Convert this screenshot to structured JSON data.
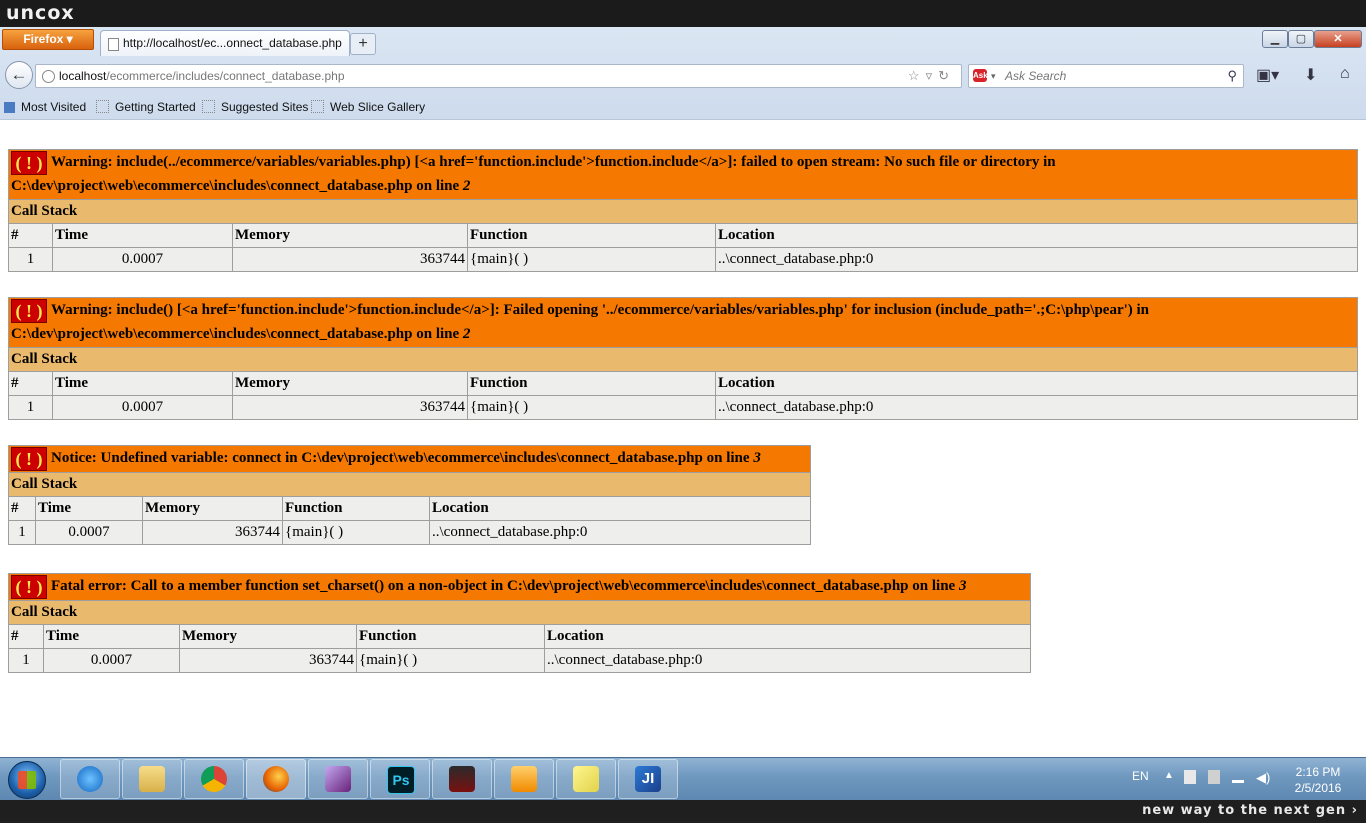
{
  "os": {
    "brand": "uncox",
    "slogan": "new way to the next gen ›",
    "tray": {
      "lang": "EN",
      "time": "2:16 PM",
      "date": "2/5/2016"
    }
  },
  "browser": {
    "menu_button": "Firefox ▾",
    "tab_title": "http://localhost/ec...onnect_database.php",
    "new_tab": "+",
    "url_host": "localhost",
    "url_path": "/ecommerce/includes/connect_database.php",
    "search_placeholder": "Ask Search",
    "bookmarks": [
      "Most Visited",
      "Getting Started",
      "Suggested Sites",
      "Web Slice Gallery"
    ]
  },
  "errors": [
    {
      "message": "Warning: include(../ecommerce/variables/variables.php) [<a href='function.include'>function.include</a>]: failed to open stream: No such file or directory in C:\\dev\\project\\web\\ecommerce\\includes\\connect_database.php on line ",
      "line": "2",
      "call_stack_label": "Call Stack",
      "columns": [
        "#",
        "Time",
        "Memory",
        "Function",
        "Location"
      ],
      "rows": [
        [
          "1",
          "0.0007",
          "363744",
          "{main}( )",
          "..\\connect_database.php:0"
        ]
      ]
    },
    {
      "message": "Warning: include() [<a href='function.include'>function.include</a>]: Failed opening '../ecommerce/variables/variables.php' for inclusion (include_path='.;C:\\php\\pear') in C:\\dev\\project\\web\\ecommerce\\includes\\connect_database.php on line ",
      "line": "2",
      "call_stack_label": "Call Stack",
      "columns": [
        "#",
        "Time",
        "Memory",
        "Function",
        "Location"
      ],
      "rows": [
        [
          "1",
          "0.0007",
          "363744",
          "{main}( )",
          "..\\connect_database.php:0"
        ]
      ]
    },
    {
      "message": "Notice: Undefined variable: connect in C:\\dev\\project\\web\\ecommerce\\includes\\connect_database.php on line ",
      "line": "3",
      "call_stack_label": "Call Stack",
      "columns": [
        "#",
        "Time",
        "Memory",
        "Function",
        "Location"
      ],
      "rows": [
        [
          "1",
          "0.0007",
          "363744",
          "{main}( )",
          "..\\connect_database.php:0"
        ]
      ]
    },
    {
      "message": "Fatal error: Call to a member function set_charset() on a non-object in C:\\dev\\project\\web\\ecommerce\\includes\\connect_database.php on line ",
      "line": "3",
      "call_stack_label": "Call Stack",
      "columns": [
        "#",
        "Time",
        "Memory",
        "Function",
        "Location"
      ],
      "rows": [
        [
          "1",
          "0.0007",
          "363744",
          "{main}( )",
          "..\\connect_database.php:0"
        ]
      ]
    }
  ],
  "error_icon_text": "( ! )",
  "colors": {
    "error_header": "#f57900",
    "call_stack_header": "#e9b96e",
    "cell_bg": "#eeeeec",
    "icon_bg": "#cc0000"
  }
}
